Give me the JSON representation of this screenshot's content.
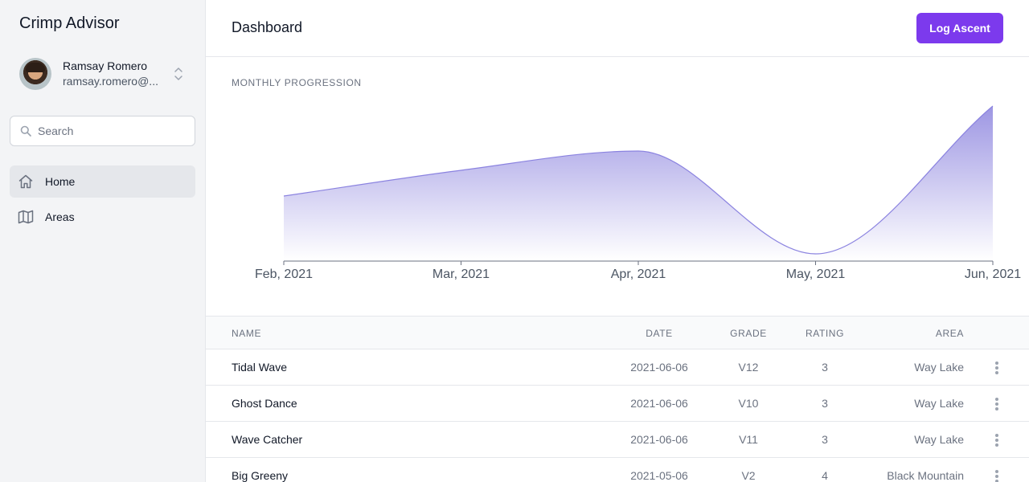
{
  "app": {
    "brand": "Crimp Advisor"
  },
  "user": {
    "name": "Ramsay Romero",
    "email": "ramsay.romero@..."
  },
  "search": {
    "placeholder": "Search"
  },
  "nav": [
    {
      "label": "Home",
      "icon": "home-icon",
      "active": true
    },
    {
      "label": "Areas",
      "icon": "map-icon",
      "active": false
    }
  ],
  "header": {
    "title": "Dashboard",
    "log_button": "Log Ascent"
  },
  "chart": {
    "section_title": "MONTHLY PROGRESSION"
  },
  "chart_data": {
    "type": "area",
    "title": "MONTHLY PROGRESSION",
    "categories": [
      "Feb, 2021",
      "Mar, 2021",
      "Apr, 2021",
      "May, 2021",
      "Jun, 2021"
    ],
    "values": [
      5,
      7,
      8.5,
      0.5,
      12
    ],
    "ylim": [
      0,
      12
    ],
    "grid": false,
    "colors": {
      "line": "#8b83e0",
      "fill_top": "#9d96e3",
      "fill_bottom": "#ffffff"
    }
  },
  "table": {
    "headers": {
      "name": "NAME",
      "date": "DATE",
      "grade": "GRADE",
      "rating": "RATING",
      "area": "AREA"
    },
    "rows": [
      {
        "name": "Tidal Wave",
        "date": "2021-06-06",
        "grade": "V12",
        "rating": "3",
        "area": "Way Lake"
      },
      {
        "name": "Ghost Dance",
        "date": "2021-06-06",
        "grade": "V10",
        "rating": "3",
        "area": "Way Lake"
      },
      {
        "name": "Wave Catcher",
        "date": "2021-06-06",
        "grade": "V11",
        "rating": "3",
        "area": "Way Lake"
      },
      {
        "name": "Big Greeny",
        "date": "2021-05-06",
        "grade": "V2",
        "rating": "4",
        "area": "Black Mountain"
      }
    ]
  },
  "colors": {
    "accent": "#7c3aed",
    "sidebar_bg": "#f3f4f6"
  }
}
